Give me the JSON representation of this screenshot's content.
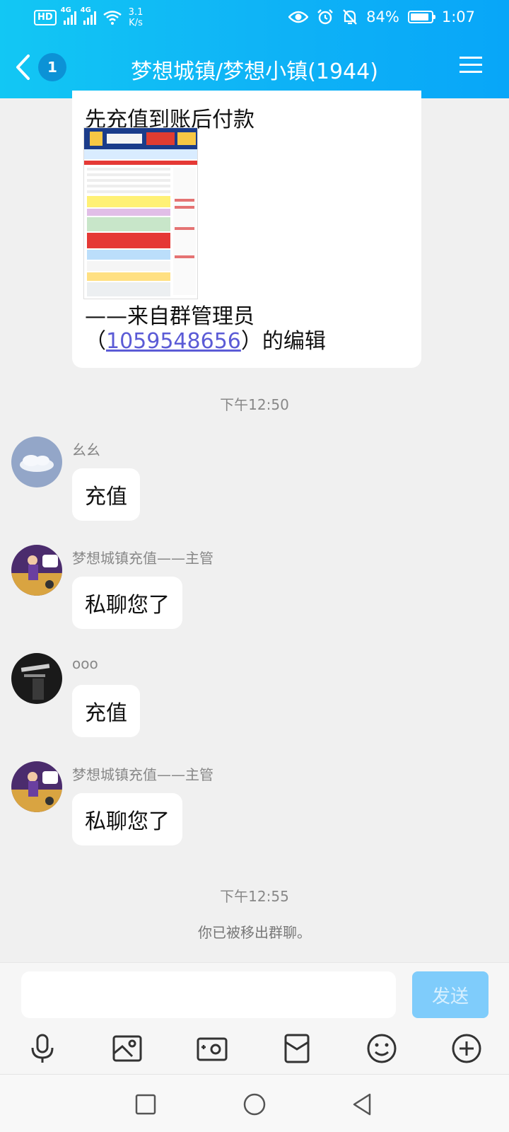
{
  "status_bar": {
    "network_badge": "HD",
    "sig1_label": "4G",
    "sig2_label": "4G",
    "speed_value": "3.1",
    "speed_unit": "K/s",
    "battery": "84%",
    "time": "1:07"
  },
  "header": {
    "back_count": "1",
    "title": "梦想城镇/梦想小镇(1944)"
  },
  "messages": {
    "announce": {
      "line1": "先充值到账后付款",
      "prefix": "——来自群管理员（",
      "admin_id": "1059548656",
      "suffix": "）的编辑"
    },
    "time1": "下午12:50",
    "m1": {
      "sender": "幺幺",
      "text": "充值"
    },
    "m2": {
      "sender": "梦想城镇充值——主管",
      "text": "私聊您了"
    },
    "m3": {
      "sender": "ooo",
      "text": "充值"
    },
    "m4": {
      "sender": "梦想城镇充值——主管",
      "text": "私聊您了"
    },
    "time2": "下午12:55",
    "system": "你已被移出群聊。"
  },
  "input": {
    "placeholder": "",
    "send_label": "发送"
  },
  "colors": {
    "header": "#0fb4f6",
    "send_button": "#7fccfb",
    "link": "#5b5bd6"
  },
  "icons": [
    "back-icon",
    "menu-icon",
    "mic-icon",
    "photo-icon",
    "camera-icon",
    "red-packet-icon",
    "emoji-icon",
    "plus-icon",
    "recent-apps-icon",
    "home-icon",
    "back-nav-icon"
  ]
}
